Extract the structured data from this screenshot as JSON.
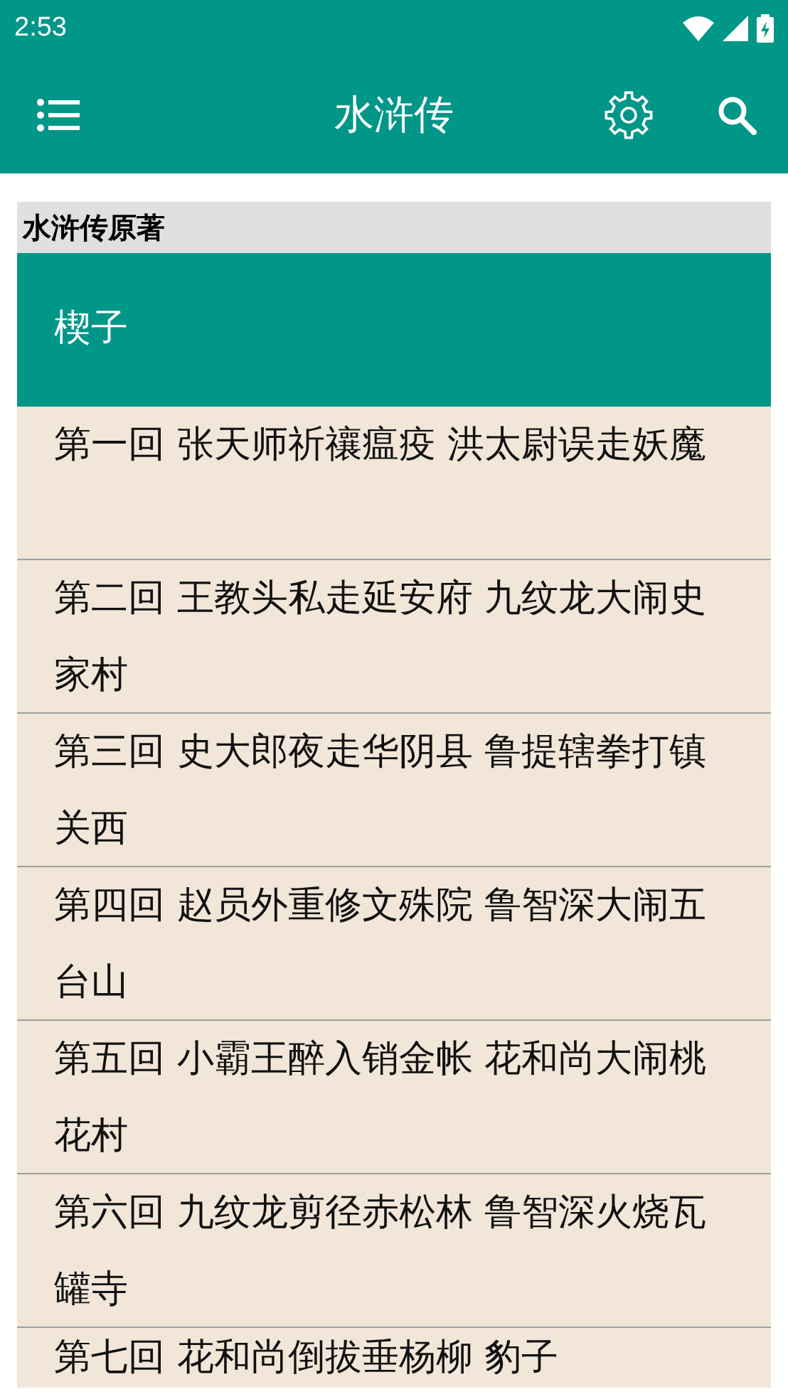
{
  "status_bar": {
    "time": "2:53"
  },
  "app_bar": {
    "title": "水浒传"
  },
  "section": {
    "title": "水浒传原著"
  },
  "chapters": [
    {
      "title": "楔子",
      "selected": true
    },
    {
      "title": "第一回 张天师祈禳瘟疫 洪太尉误走妖魔",
      "selected": false
    },
    {
      "title": "第二回 王教头私走延安府 九纹龙大闹史家村",
      "selected": false
    },
    {
      "title": "第三回 史大郎夜走华阴县 鲁提辖拳打镇关西",
      "selected": false
    },
    {
      "title": "第四回 赵员外重修文殊院 鲁智深大闹五台山",
      "selected": false
    },
    {
      "title": "第五回 小霸王醉入销金帐 花和尚大闹桃花村",
      "selected": false
    },
    {
      "title": "第六回 九纹龙剪径赤松林 鲁智深火烧瓦罐寺",
      "selected": false
    },
    {
      "title": "第七回 花和尚倒拔垂杨柳 豹子",
      "selected": false
    }
  ]
}
